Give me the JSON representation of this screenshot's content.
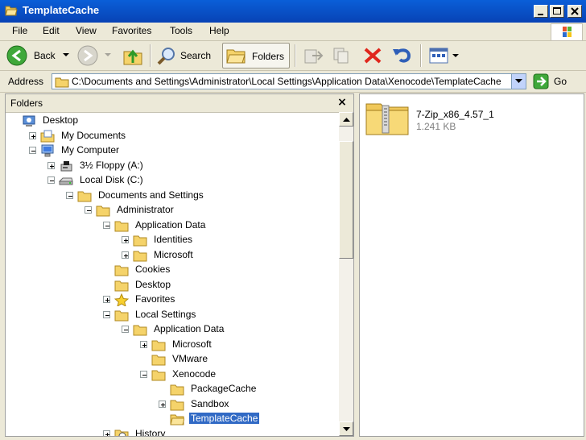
{
  "window": {
    "title": "TemplateCache"
  },
  "menu": [
    "File",
    "Edit",
    "View",
    "Favorites",
    "Tools",
    "Help"
  ],
  "toolbar": {
    "back": "Back",
    "search": "Search",
    "folders": "Folders"
  },
  "address": {
    "label": "Address",
    "path": "C:\\Documents and Settings\\Administrator\\Local Settings\\Application Data\\Xenocode\\TemplateCache",
    "go": "Go"
  },
  "folders_pane": {
    "title": "Folders",
    "close": "×",
    "tree": [
      {
        "label": "Desktop",
        "depth": 0,
        "expander": "none",
        "icon": "desktop-icon"
      },
      {
        "label": "My Documents",
        "depth": 1,
        "expander": "plus",
        "icon": "my-documents-icon"
      },
      {
        "label": "My Computer",
        "depth": 1,
        "expander": "minus",
        "icon": "my-computer-icon"
      },
      {
        "label": "3½ Floppy (A:)",
        "depth": 2,
        "expander": "plus",
        "icon": "floppy-icon"
      },
      {
        "label": "Local Disk (C:)",
        "depth": 2,
        "expander": "minus",
        "icon": "drive-icon"
      },
      {
        "label": "Documents and Settings",
        "depth": 3,
        "expander": "minus",
        "icon": "folder-icon"
      },
      {
        "label": "Administrator",
        "depth": 4,
        "expander": "minus",
        "icon": "folder-icon"
      },
      {
        "label": "Application Data",
        "depth": 5,
        "expander": "minus",
        "icon": "folder-icon"
      },
      {
        "label": "Identities",
        "depth": 6,
        "expander": "plus",
        "icon": "folder-icon"
      },
      {
        "label": "Microsoft",
        "depth": 6,
        "expander": "plus",
        "icon": "folder-icon"
      },
      {
        "label": "Cookies",
        "depth": 5,
        "expander": "none",
        "icon": "folder-icon"
      },
      {
        "label": "Desktop",
        "depth": 5,
        "expander": "none",
        "icon": "folder-icon"
      },
      {
        "label": "Favorites",
        "depth": 5,
        "expander": "plus",
        "icon": "favorites-star-icon"
      },
      {
        "label": "Local Settings",
        "depth": 5,
        "expander": "minus",
        "icon": "folder-icon"
      },
      {
        "label": "Application Data",
        "depth": 6,
        "expander": "minus",
        "icon": "folder-icon"
      },
      {
        "label": "Microsoft",
        "depth": 7,
        "expander": "plus",
        "icon": "folder-icon"
      },
      {
        "label": "VMware",
        "depth": 7,
        "expander": "none",
        "icon": "folder-icon"
      },
      {
        "label": "Xenocode",
        "depth": 7,
        "expander": "minus",
        "icon": "folder-icon"
      },
      {
        "label": "PackageCache",
        "depth": 8,
        "expander": "none",
        "icon": "folder-icon"
      },
      {
        "label": "Sandbox",
        "depth": 8,
        "expander": "plus",
        "icon": "folder-icon"
      },
      {
        "label": "TemplateCache",
        "depth": 8,
        "expander": "none",
        "icon": "folder-open-icon",
        "selected": true
      },
      {
        "label": "History",
        "depth": 5,
        "expander": "plus",
        "icon": "history-icon"
      }
    ]
  },
  "files": [
    {
      "name": "7-Zip_x86_4.57_1",
      "size": "1.241 KB",
      "icon": "zip-folder-icon"
    }
  ],
  "colors": {
    "title_bar": "#0a5fd8",
    "selection": "#316ac5",
    "window_bg": "#ece9d8"
  }
}
